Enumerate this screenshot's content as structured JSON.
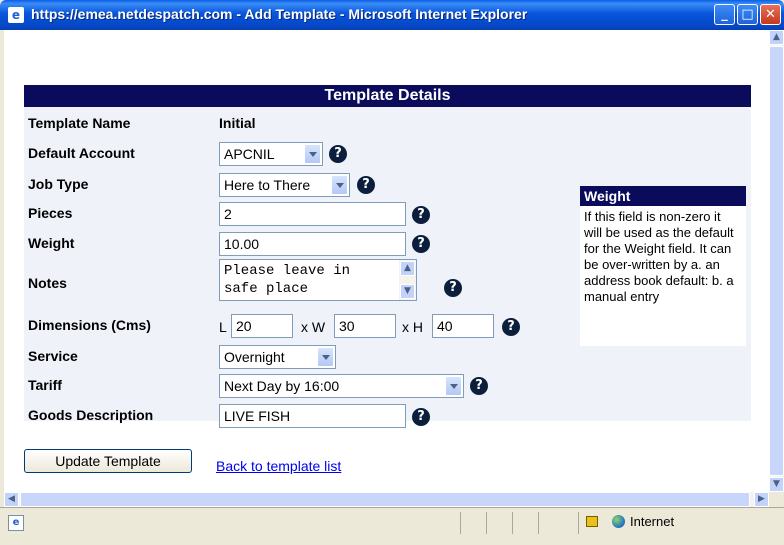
{
  "window": {
    "title": "https://emea.netdespatch.com - Add Template - Microsoft Internet Explorer",
    "icon": "ie-icon",
    "buttons": {
      "minimize": "_",
      "maximize": "□",
      "close": "✕"
    }
  },
  "form": {
    "heading": "Template Details",
    "template_name": {
      "label": "Template Name",
      "value": "Initial"
    },
    "default_account": {
      "label": "Default Account",
      "value": "APCNIL"
    },
    "job_type": {
      "label": "Job Type",
      "value": "Here to There"
    },
    "pieces": {
      "label": "Pieces",
      "value": "2"
    },
    "weight": {
      "label": "Weight",
      "value": "10.00"
    },
    "notes": {
      "label": "Notes",
      "value": "Please leave in\nsafe place"
    },
    "dimensions": {
      "label": "Dimensions (Cms)",
      "l_label": "L",
      "l_value": "20",
      "w_label": "x W",
      "w_value": "30",
      "h_label": "x H",
      "h_value": "40"
    },
    "service": {
      "label": "Service",
      "value": "Overnight"
    },
    "tariff": {
      "label": "Tariff",
      "value": "Next Day by 16:00"
    },
    "goods_description": {
      "label": "Goods Description",
      "value": "LIVE FISH"
    },
    "help_glyph": "?"
  },
  "help_box": {
    "title": "Weight",
    "text": "If this field is non-zero it will be used as the default for the Weight field. It can be over-written by a. an address book default: b. a manual entry"
  },
  "actions": {
    "update_button": "Update Template",
    "back_link": "Back to template list"
  },
  "statusbar": {
    "zone": "Internet"
  },
  "colors": {
    "header_bg": "#0b0b5c",
    "panel_bg": "#f0f2fa",
    "link": "#0000ee"
  }
}
